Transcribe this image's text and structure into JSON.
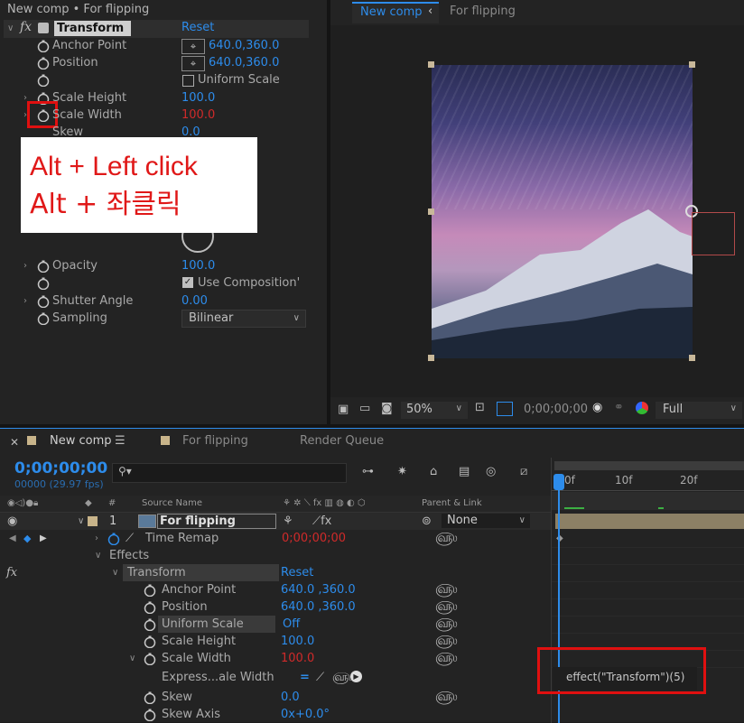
{
  "colors": {
    "accent": "#2d8ceb",
    "changed": "#d02a2a",
    "highlight": "#e01010"
  },
  "effect_controls": {
    "title": "New comp • For flipping",
    "effect_name": "Transform",
    "reset": "Reset",
    "props": [
      {
        "label": "Anchor Point",
        "x": "640.0",
        "y": ",360.0"
      },
      {
        "label": "Position",
        "x": "640.0",
        "y": ",360.0"
      },
      {
        "label": "Uniform Scale",
        "value": ""
      },
      {
        "label": "Scale Height",
        "value": "100.0"
      },
      {
        "label": "Scale Width",
        "value": "100.0"
      },
      {
        "label": "Skew",
        "value": "0.0"
      },
      {
        "label": "Opacity",
        "value": "100.0"
      },
      {
        "label": "Use Composition'",
        "value": ""
      },
      {
        "label": "Shutter Angle",
        "value": "0.00"
      },
      {
        "label": "Sampling",
        "value": "Bilinear"
      }
    ]
  },
  "callout": {
    "line1": "Alt + Left click",
    "line2": "Alt + 좌클릭"
  },
  "viewer": {
    "tabs": [
      "New comp",
      "For flipping"
    ],
    "zoom": "50%",
    "timecode": "0;00;00;00",
    "resolution": "Full"
  },
  "timeline": {
    "tabs": [
      "New comp",
      "For flipping",
      "Render Queue"
    ],
    "timecode": "0;00;00;00",
    "fps": "00000 (29.97 fps)",
    "search_placeholder": "",
    "headers": {
      "num": "#",
      "source": "Source Name",
      "parent": "Parent & Link"
    },
    "layer": {
      "num": "1",
      "name": "For flipping",
      "parent": "None"
    },
    "rows": [
      {
        "label": "Time Remap",
        "value": "0;00;00;00"
      },
      {
        "label": "Effects",
        "value": ""
      },
      {
        "label": "Transform",
        "value": "Reset"
      },
      {
        "label": "Anchor Point",
        "value": "640.0 ,360.0"
      },
      {
        "label": "Position",
        "value": "640.0 ,360.0"
      },
      {
        "label": "Uniform Scale",
        "value": "Off"
      },
      {
        "label": "Scale Height",
        "value": "100.0"
      },
      {
        "label": "Scale Width",
        "value": "100.0"
      },
      {
        "label": "Express...ale Width",
        "value": ""
      },
      {
        "label": "Skew",
        "value": "0.0"
      },
      {
        "label": "Skew Axis",
        "value": "0x+0.0°"
      }
    ],
    "ruler": [
      "0f",
      "10f",
      "20f"
    ],
    "expression": "effect(\"Transform\")(5)"
  }
}
